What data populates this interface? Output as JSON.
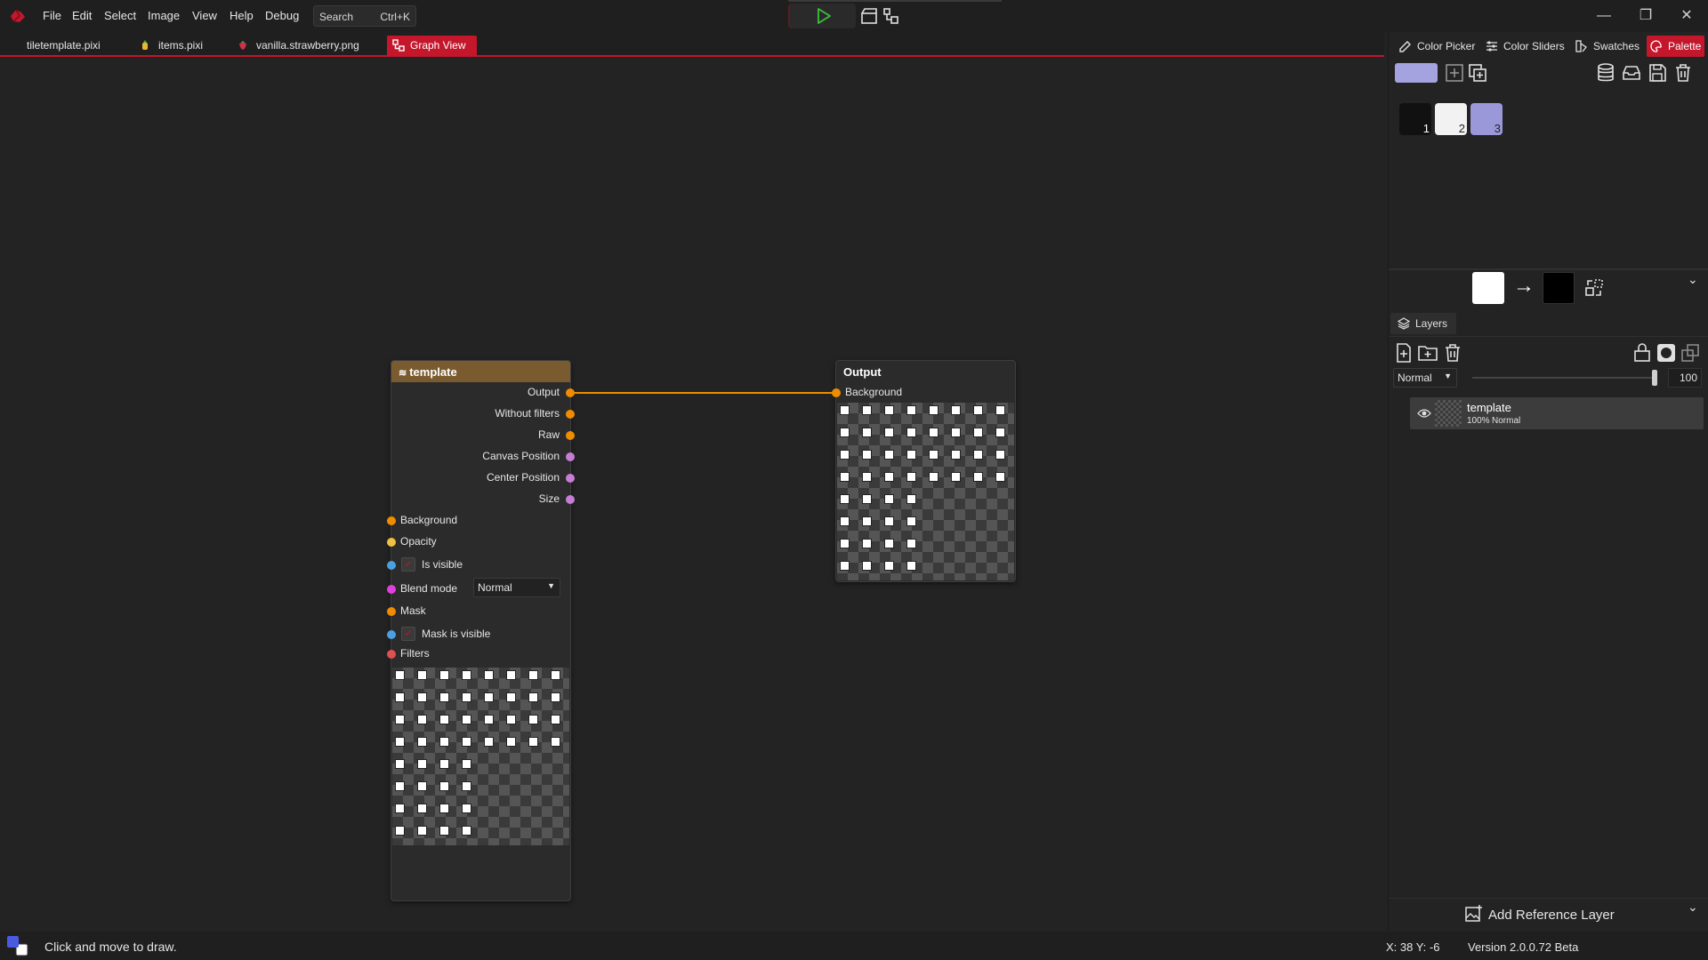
{
  "menu": {
    "items": [
      "File",
      "Edit",
      "Select",
      "Image",
      "View",
      "Help",
      "Debug"
    ],
    "search_placeholder": "Search",
    "search_shortcut": "Ctrl+K"
  },
  "window_controls": {
    "minimize": "—",
    "maximize": "❐",
    "close": "✕"
  },
  "doc_tabs": [
    {
      "label": "tiletemplate.pixi"
    },
    {
      "label": "items.pixi"
    },
    {
      "label": "vanilla.strawberry.png"
    },
    {
      "label": "Graph View",
      "active": true
    }
  ],
  "template_node": {
    "title": "template",
    "outputs": [
      "Output",
      "Without filters",
      "Raw",
      "Canvas Position",
      "Center Position",
      "Size"
    ],
    "inputs": {
      "background": "Background",
      "opacity": "Opacity",
      "is_visible": "Is visible",
      "blend_mode": "Blend mode",
      "blend_mode_value": "Normal",
      "mask": "Mask",
      "mask_is_visible": "Mask is visible",
      "filters": "Filters"
    },
    "port_colors": {
      "texture": "#f08c00",
      "vector": "#c77dd6",
      "bool": "#4aa0e0",
      "number": "#f0c040",
      "blend": "#e040e0",
      "filter": "#e05050"
    }
  },
  "output_node": {
    "title": "Output",
    "input": "Background"
  },
  "right_panel": {
    "tabs": [
      {
        "label": "Color Picker",
        "icon": "color-picker-icon"
      },
      {
        "label": "Color Sliders",
        "icon": "sliders-icon"
      },
      {
        "label": "Swatches",
        "icon": "swatches-icon"
      },
      {
        "label": "Palette",
        "icon": "palette-icon",
        "active": true
      }
    ],
    "current_color": "#a4a3e0",
    "swatches": [
      {
        "number": "1",
        "color": "#111111"
      },
      {
        "number": "2",
        "color": "#f2f2f2"
      },
      {
        "number": "3",
        "color": "#9a98d8"
      }
    ],
    "primary_color": "#ffffff",
    "secondary_color": "#000000",
    "swap_arrow": "→"
  },
  "layers": {
    "tab_label": "Layers",
    "blend_mode": "Normal",
    "opacity_value": "100",
    "opacity_fraction": 1.0,
    "items": [
      {
        "name": "template",
        "opacity": "100%",
        "blend": "Normal"
      }
    ],
    "add_reference_label": "Add Reference Layer"
  },
  "status": {
    "hint": "Click and move to draw.",
    "coords": "X: 38 Y: -6",
    "version": "Version 2.0.0.72 Beta"
  }
}
